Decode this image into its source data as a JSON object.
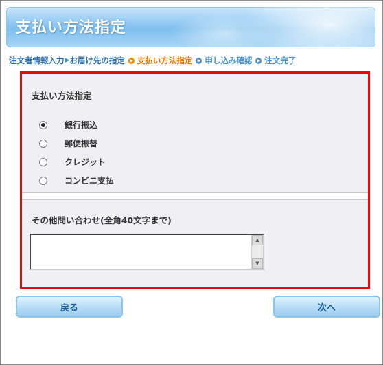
{
  "header": {
    "title": "支払い方法指定"
  },
  "steps": [
    {
      "label": "注文者情報入力",
      "state": "done"
    },
    {
      "label": "お届け先の指定",
      "state": "done"
    },
    {
      "label": "支払い方法指定",
      "state": "current"
    },
    {
      "label": "申し込み確認",
      "state": "todo"
    },
    {
      "label": "注文完了",
      "state": "todo"
    }
  ],
  "payment": {
    "title": "支払い方法指定",
    "options": [
      {
        "label": "銀行振込",
        "checked": true
      },
      {
        "label": "郵便振替",
        "checked": false
      },
      {
        "label": "クレジット",
        "checked": false
      },
      {
        "label": "コンビニ支払",
        "checked": false
      }
    ]
  },
  "inquiry": {
    "label": "その他問い合わせ(全角40文字まで)",
    "value": ""
  },
  "buttons": {
    "back": "戻る",
    "next": "次へ"
  },
  "colors": {
    "highlight_border": "#ff0000",
    "current_step": "#e07a00",
    "button_text": "#1f5f99"
  },
  "icons": {
    "step_marker": "circle-arrow-icon",
    "scroll_up": "arrow-up-icon",
    "scroll_down": "arrow-down-icon"
  }
}
